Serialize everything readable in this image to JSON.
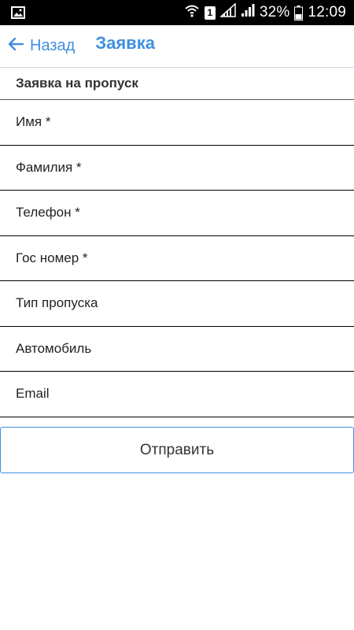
{
  "status_bar": {
    "battery": "32%",
    "time": "12:09",
    "sim_label": "1",
    "icons": [
      "gallery-icon",
      "wifi-icon",
      "sim-icon",
      "signal-icon",
      "signal-icon",
      "battery-icon"
    ]
  },
  "header": {
    "back_label": "Назад",
    "title": "Заявка",
    "accent_color": "#3f8fe0"
  },
  "form": {
    "section_title": "Заявка на пропуск",
    "fields": [
      {
        "placeholder": "Имя *",
        "value": ""
      },
      {
        "placeholder": "Фамилия *",
        "value": ""
      },
      {
        "placeholder": "Телефон *",
        "value": ""
      },
      {
        "placeholder": "Гос номер *",
        "value": ""
      },
      {
        "placeholder": "Тип пропуска",
        "value": ""
      },
      {
        "placeholder": "Автомобиль",
        "value": ""
      },
      {
        "placeholder": "Email",
        "value": ""
      }
    ],
    "submit_label": "Отправить"
  }
}
